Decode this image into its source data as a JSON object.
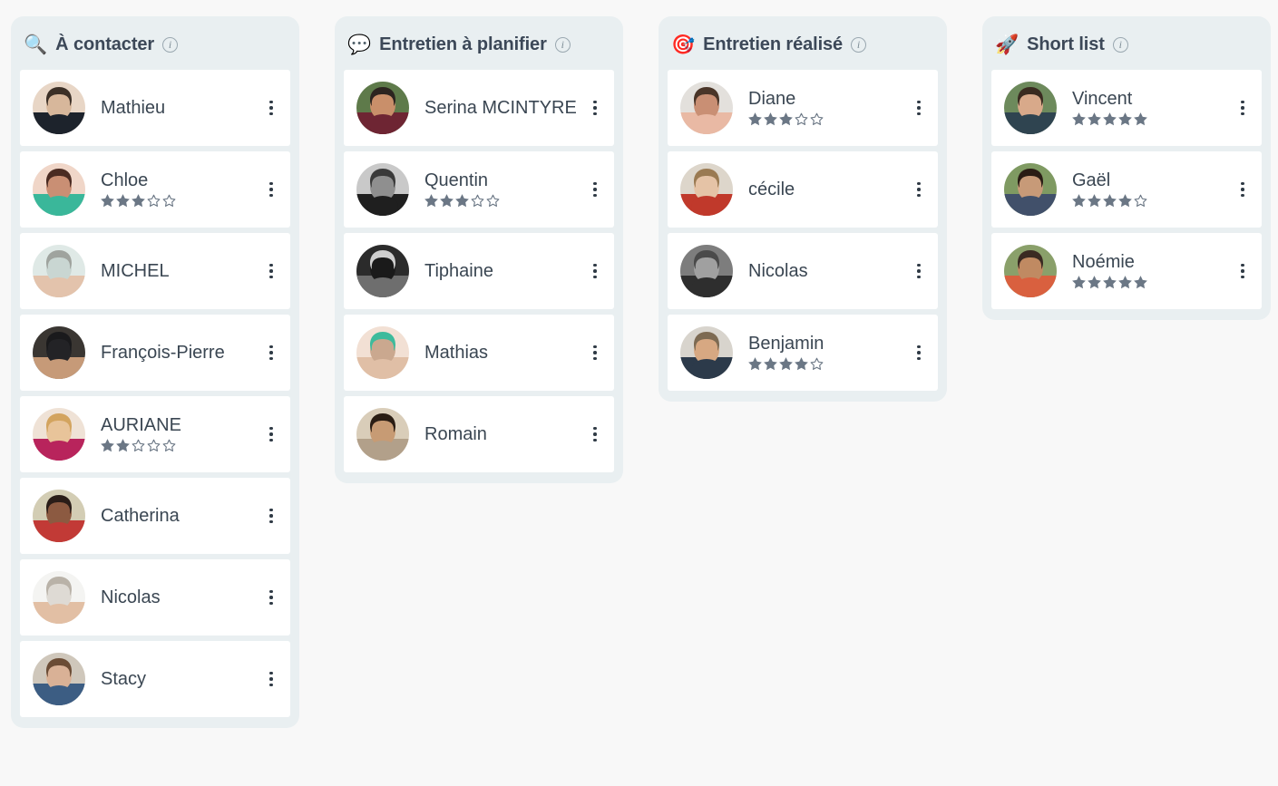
{
  "board": {
    "columns": [
      {
        "id": "a-contacter",
        "emoji": "🔍",
        "icon_name": "magnifying-glass-icon",
        "title": "À contacter",
        "info_label": "i",
        "cards": [
          {
            "name": "Mathieu",
            "rating": 0,
            "avatar": "mathieu"
          },
          {
            "name": "Chloe",
            "rating": 3,
            "avatar": "chloe"
          },
          {
            "name": "MICHEL",
            "rating": 0,
            "avatar": "michel"
          },
          {
            "name": "François-Pierre",
            "rating": 0,
            "avatar": "francois"
          },
          {
            "name": "AURIANE",
            "rating": 2,
            "avatar": "auriane"
          },
          {
            "name": "Catherina",
            "rating": 0,
            "avatar": "catherina"
          },
          {
            "name": "Nicolas",
            "rating": 0,
            "avatar": "nicolas1"
          },
          {
            "name": "Stacy",
            "rating": 0,
            "avatar": "stacy"
          }
        ]
      },
      {
        "id": "entretien-a-planifier",
        "emoji": "💬",
        "icon_name": "speech-balloon-icon",
        "title": "Entretien à planifier",
        "info_label": "i",
        "cards": [
          {
            "name": "Serina MCINTYRE",
            "rating": 0,
            "avatar": "serina"
          },
          {
            "name": "Quentin",
            "rating": 3,
            "avatar": "quentin"
          },
          {
            "name": "Tiphaine",
            "rating": 0,
            "avatar": "tiphaine"
          },
          {
            "name": "Mathias",
            "rating": 0,
            "avatar": "mathias"
          },
          {
            "name": "Romain",
            "rating": 0,
            "avatar": "romain"
          }
        ]
      },
      {
        "id": "entretien-realise",
        "emoji": "🎯",
        "icon_name": "direct-hit-icon",
        "title": "Entretien réalisé",
        "info_label": "i",
        "cards": [
          {
            "name": "Diane",
            "rating": 3,
            "avatar": "diane"
          },
          {
            "name": "cécile",
            "rating": 0,
            "avatar": "cecile"
          },
          {
            "name": "Nicolas",
            "rating": 0,
            "avatar": "nicolas2"
          },
          {
            "name": "Benjamin",
            "rating": 4,
            "avatar": "benjamin"
          }
        ]
      },
      {
        "id": "short-list",
        "emoji": "🚀",
        "icon_name": "rocket-icon",
        "title": "Short list",
        "info_label": "i",
        "cards": [
          {
            "name": "Vincent",
            "rating": 5,
            "avatar": "vincent"
          },
          {
            "name": "Gaël",
            "rating": 4,
            "avatar": "gael"
          },
          {
            "name": "Noémie",
            "rating": 5,
            "avatar": "noemie"
          }
        ]
      }
    ]
  },
  "rating": {
    "max": 5
  },
  "colors": {
    "page_background": "#f8f8f8",
    "column_background": "#e9eff1",
    "card_background": "#ffffff",
    "title_text": "#3c4858",
    "name_text": "#3a4652",
    "star_filled": "#6b7785",
    "star_empty_outline": "#6b7785",
    "menu_dot": "#2f3a45"
  }
}
